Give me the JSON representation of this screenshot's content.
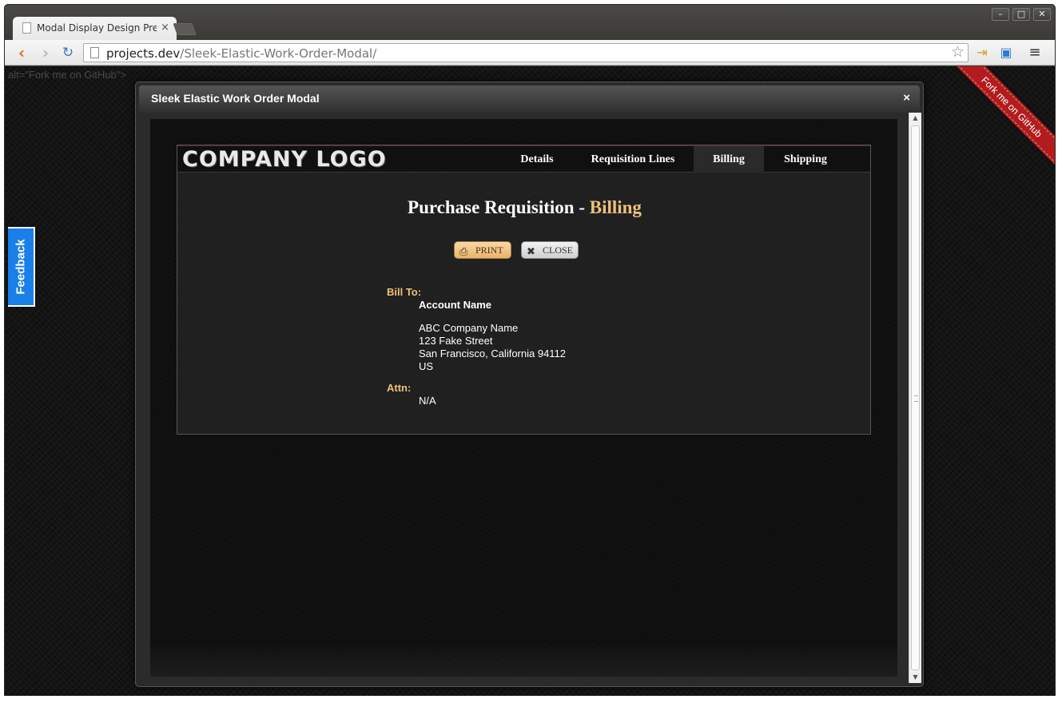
{
  "browser": {
    "tab_title": "Modal Display Design Prev",
    "tab_close": "×",
    "url_host": "projects.dev",
    "url_path": "/Sleek-Elastic-Work-Order-Modal/",
    "window_controls": {
      "minimize": "–",
      "maximize": "□",
      "close": "✕"
    }
  },
  "page": {
    "alt_text": "alt=\"Fork me on GitHub\">",
    "ribbon": "Fork me on GitHub",
    "feedback": "Feedback"
  },
  "modal": {
    "title": "Sleek Elastic Work Order Modal",
    "close": "×",
    "logo": "COMPANY LOGO",
    "nav": [
      {
        "label": "Details",
        "active": false
      },
      {
        "label": "Requisition Lines",
        "active": false
      },
      {
        "label": "Billing",
        "active": true
      },
      {
        "label": "Shipping",
        "active": false
      }
    ],
    "heading_main": "Purchase Requisition - ",
    "heading_accent": "Billing",
    "buttons": {
      "print": "PRINT",
      "close": "CLOSE"
    },
    "bill_to": {
      "label": "Bill To:",
      "account_name": "Account Name",
      "company": "ABC Company Name",
      "street": "123 Fake Street",
      "city_state_zip": "San Francisco, California 94112",
      "country": "US"
    },
    "attn": {
      "label": "Attn:",
      "value": "N/A"
    }
  },
  "colors": {
    "accent": "#f0c07a",
    "feedback": "#1a7fe8",
    "ribbon": "#b21c1c"
  }
}
